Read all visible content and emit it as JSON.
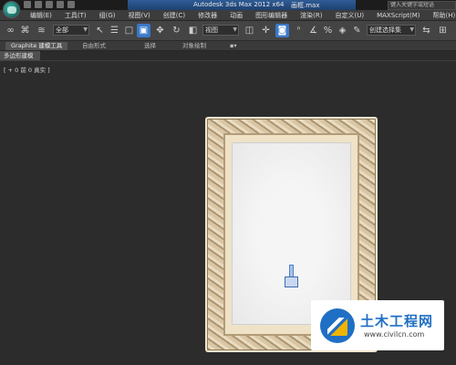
{
  "window": {
    "title": "Autodesk 3ds Max  2012 x64",
    "file": "画框.max",
    "search_placeholder": "键入关键字或短语"
  },
  "menu": [
    "编辑(E)",
    "工具(T)",
    "组(G)",
    "视图(V)",
    "创建(C)",
    "修改器",
    "动画",
    "图形编辑器",
    "渲染(R)",
    "自定义(U)",
    "MAXScript(M)",
    "帮助(H)"
  ],
  "toolbar": {
    "selection_filter": "全部",
    "reference_coord": "视图",
    "named_selection": "创建选择集"
  },
  "ribbon": {
    "tabs": [
      "Graphite 建模工具",
      "自由形式",
      "选择",
      "对象绘制"
    ],
    "active_tab": "Graphite 建模工具"
  },
  "panel": {
    "label": "多边形建模"
  },
  "viewport": {
    "label": "[ + 0 前 0 真实 ]"
  },
  "watermark": {
    "title": "土木工程网",
    "url": "www.civilcn.com"
  },
  "colors": {
    "accent": "#3a79c8",
    "frame": "#d9c6a4",
    "watermark_brand": "#1f6fc4"
  }
}
